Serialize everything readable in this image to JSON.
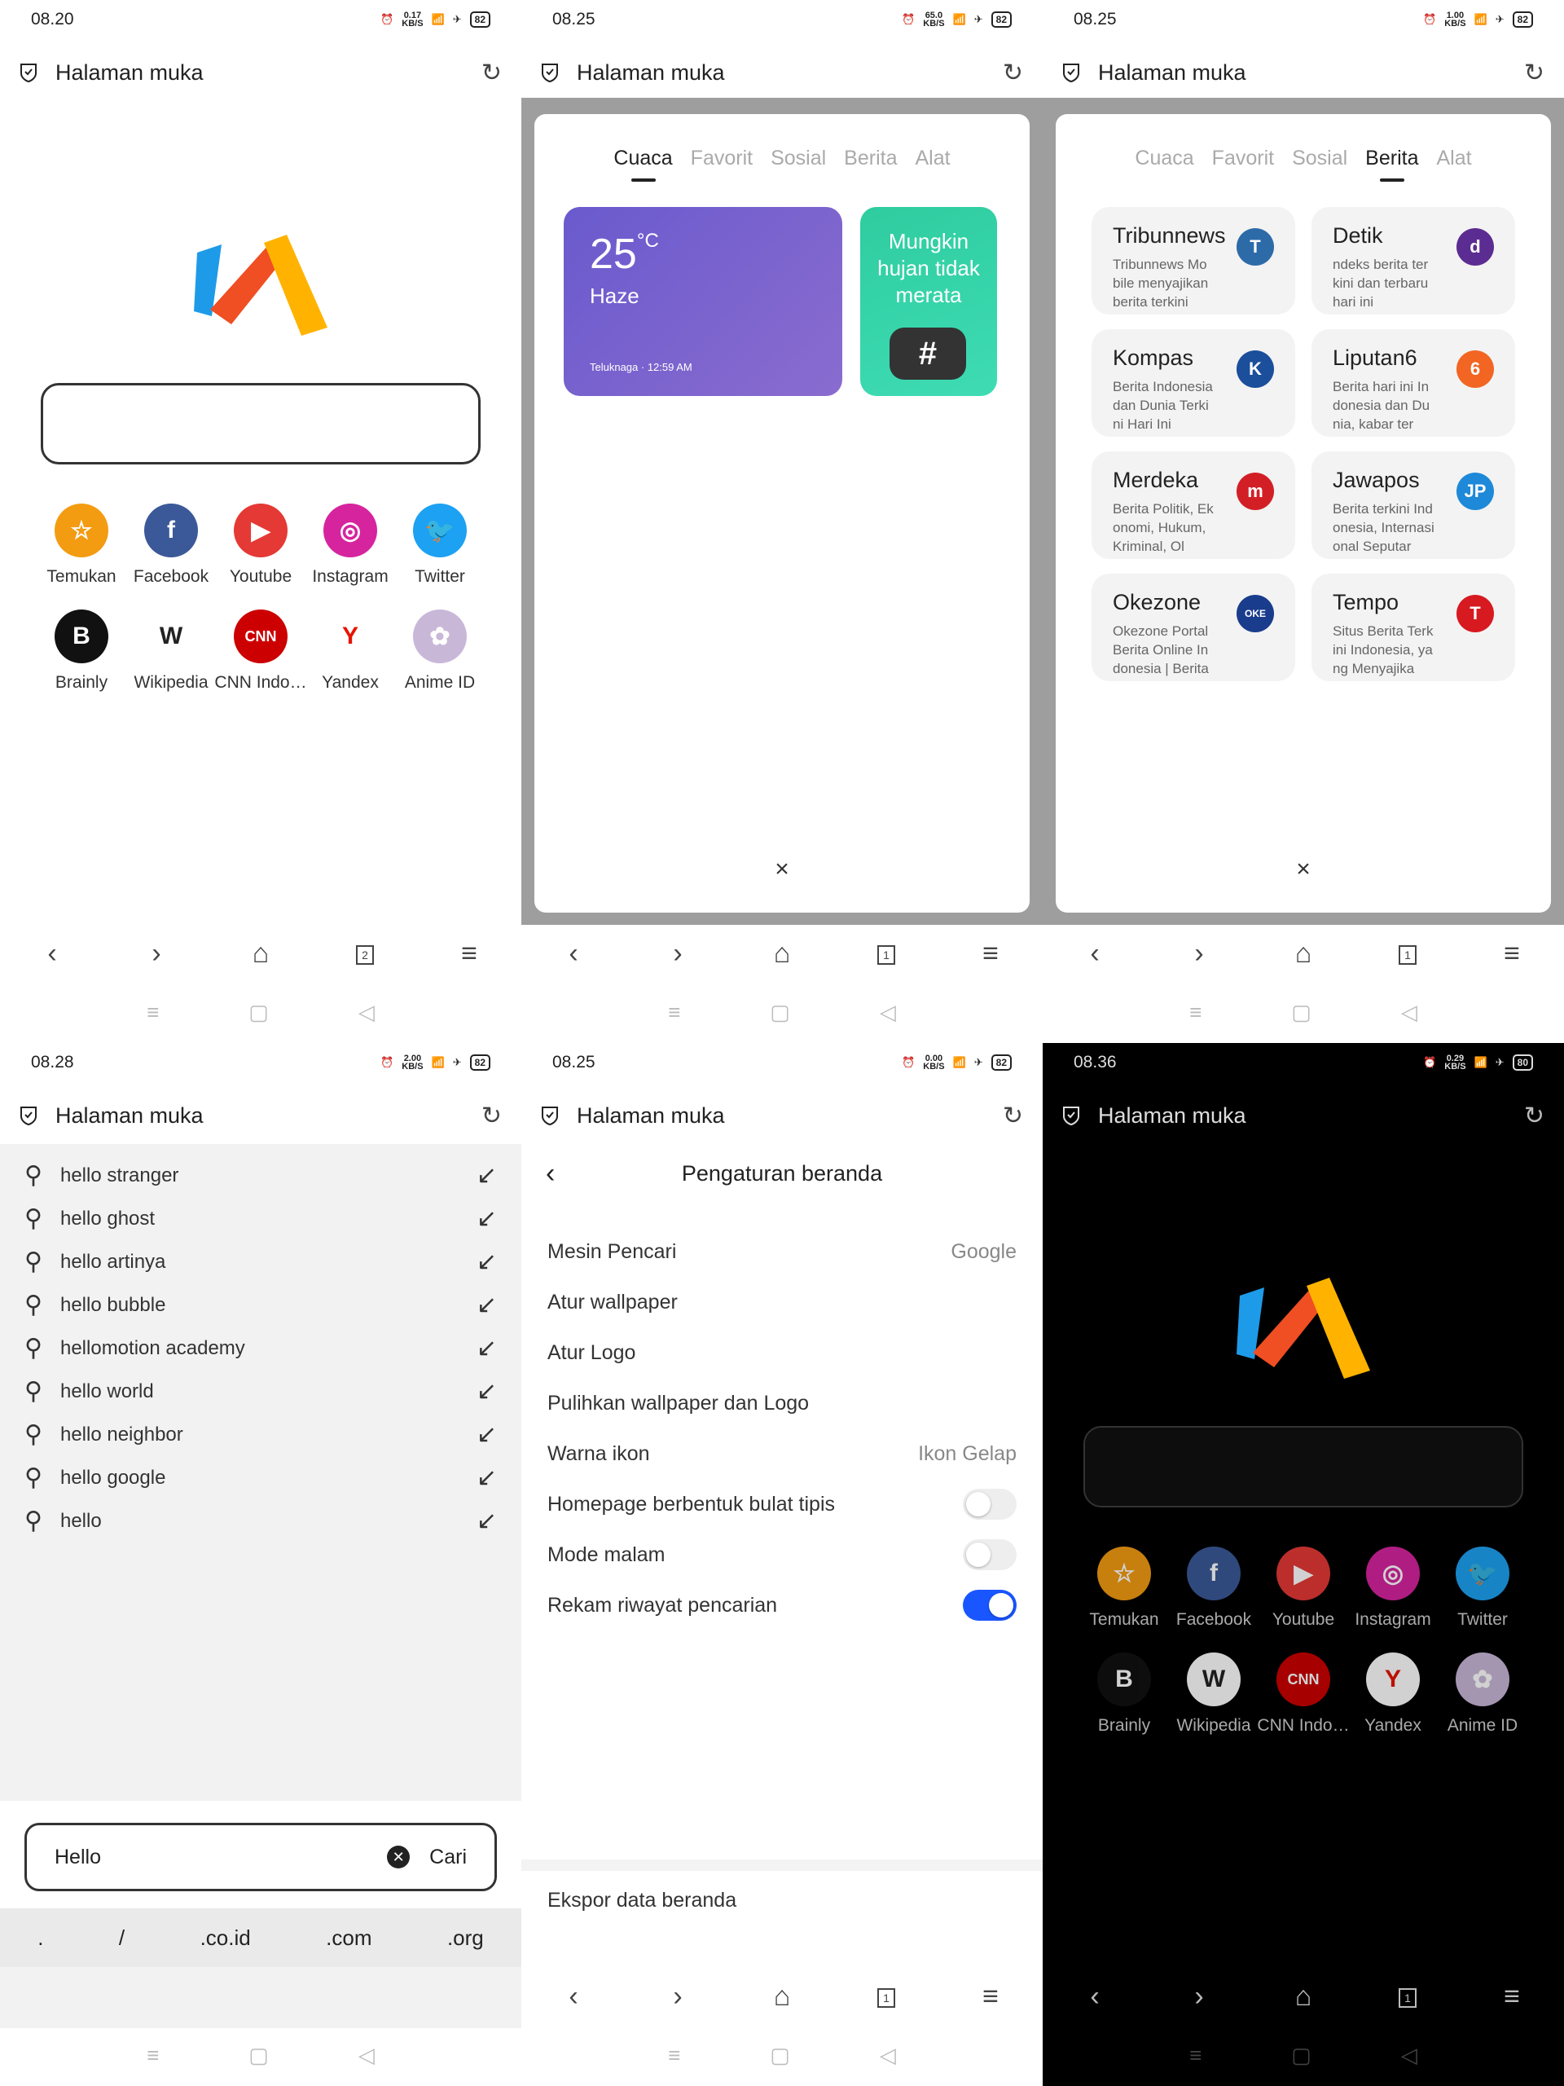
{
  "address": {
    "title": "Halaman muka"
  },
  "toolbar": {
    "tabs_p1": "2",
    "tabs_other": "1"
  },
  "p1": {
    "time": "08.20",
    "net": "0.17",
    "bat": "82"
  },
  "p2": {
    "time": "08.25",
    "net": "65.0",
    "bat": "82"
  },
  "p3": {
    "time": "08.25",
    "net": "1.00",
    "bat": "82"
  },
  "p4": {
    "time": "08.28",
    "net": "2.00",
    "bat": "82"
  },
  "p5": {
    "time": "08.25",
    "net": "0.00",
    "bat": "82"
  },
  "p6": {
    "time": "08.36",
    "net": "0.29",
    "bat": "80"
  },
  "net_unit": "KB/S",
  "shortcuts": [
    {
      "label": "Temukan",
      "color": "#f39c12",
      "glyph": "☆"
    },
    {
      "label": "Facebook",
      "color": "#3b5998",
      "glyph": "f"
    },
    {
      "label": "Youtube",
      "color": "#e53935",
      "glyph": "▶"
    },
    {
      "label": "Instagram",
      "color": "#d6249f",
      "glyph": "◎"
    },
    {
      "label": "Twitter",
      "color": "#1da1f2",
      "glyph": "🐦"
    },
    {
      "label": "Brainly",
      "color": "#111111",
      "glyph": "B"
    },
    {
      "label": "Wikipedia",
      "color": "#ffffff",
      "glyph": "W"
    },
    {
      "label": "CNN Indo…",
      "color": "#cc0000",
      "glyph": "CNN"
    },
    {
      "label": "Yandex",
      "color": "#ffffff",
      "glyph": "Y"
    },
    {
      "label": "Anime ID",
      "color": "#c9b7d8",
      "glyph": "✿"
    }
  ],
  "tabs": [
    "Cuaca",
    "Favorit",
    "Sosial",
    "Berita",
    "Alat"
  ],
  "weather": {
    "temp": "25",
    "unit": "°C",
    "condition": "Haze",
    "location": "Teluknaga · 12:59 AM"
  },
  "rain": {
    "text": "Mungkin hujan tidak merata",
    "hash": "#"
  },
  "close": "×",
  "news": [
    {
      "title": "Tribunnews",
      "desc": "Tribunnews Mobile menyajikan berita terkini",
      "logo": "T",
      "color": "#2d6ba8"
    },
    {
      "title": "Detik",
      "desc": "ndeks berita terkini dan terbaru hari ini",
      "logo": "d",
      "color": "#5b2c91"
    },
    {
      "title": "Kompas",
      "desc": "Berita Indonesia dan Dunia Terkini Hari Ini",
      "logo": "K",
      "color": "#1b4e9b"
    },
    {
      "title": "Liputan6",
      "desc": "Berita hari ini Indonesia dan Dunia, kabar ter",
      "logo": "6",
      "color": "#f26522"
    },
    {
      "title": "Merdeka",
      "desc": "Berita Politik, Ekonomi, Hukum, Kriminal, Ol",
      "logo": "m",
      "color": "#d21f26"
    },
    {
      "title": "Jawapos",
      "desc": "Berita terkini Indonesia, Internasional Seputar",
      "logo": "JP",
      "color": "#1d89d8"
    },
    {
      "title": "Okezone",
      "desc": "Okezone Portal Berita Online Indonesia | Berita",
      "logo": "OKE",
      "color": "#1a3c8c"
    },
    {
      "title": "Tempo",
      "desc": "Situs Berita Terkini Indonesia, yang Menyajika",
      "logo": "T",
      "color": "#d71920"
    }
  ],
  "suggestions": [
    "hello stranger",
    "hello ghost",
    "hello artinya",
    "hello bubble",
    "hellomotion academy",
    "hello world",
    "hello neighbor",
    "hello google",
    "hello"
  ],
  "search": {
    "value": "Hello",
    "cari": "Cari"
  },
  "domains": [
    ".",
    "/",
    ".co.id",
    ".com",
    ".org"
  ],
  "settings": {
    "title": "Pengaturan beranda",
    "rows": [
      {
        "label": "Mesin Pencari",
        "value": "Google"
      },
      {
        "label": "Atur wallpaper",
        "value": ""
      },
      {
        "label": "Atur Logo",
        "value": ""
      },
      {
        "label": "Pulihkan wallpaper dan Logo",
        "value": ""
      },
      {
        "label": "Warna ikon",
        "value": "Ikon Gelap"
      }
    ],
    "toggles": [
      {
        "label": "Homepage berbentuk bulat tipis",
        "on": false
      },
      {
        "label": "Mode malam",
        "on": false
      },
      {
        "label": "Rekam riwayat pencarian",
        "on": true
      }
    ],
    "export": "Ekspor data beranda"
  }
}
